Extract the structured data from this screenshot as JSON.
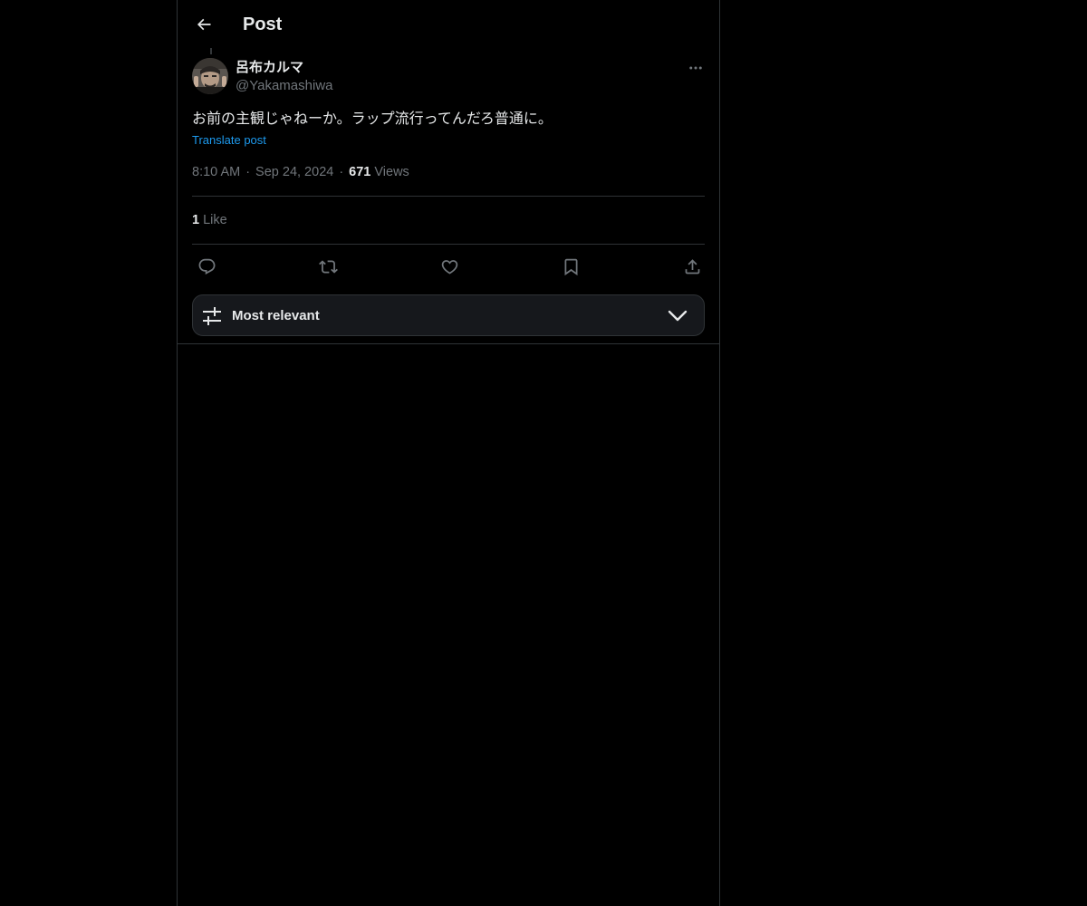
{
  "header": {
    "title": "Post",
    "back_icon": "arrow-left-icon"
  },
  "post": {
    "author": {
      "display_name": "呂布カルマ",
      "handle": "@Yakamashiwa"
    },
    "text": "お前の主観じゃねーか。ラップ流行ってんだろ普通に。",
    "translate_label": "Translate post",
    "time": "8:10 AM",
    "date": "Sep 24, 2024",
    "separator": "·",
    "views_count": "671",
    "views_label": "Views",
    "likes_count": "1",
    "likes_label": "Like"
  },
  "actions": [
    {
      "name": "reply-icon"
    },
    {
      "name": "repost-icon"
    },
    {
      "name": "like-icon"
    },
    {
      "name": "bookmark-icon"
    },
    {
      "name": "share-icon"
    }
  ],
  "sort": {
    "label": "Most relevant",
    "icon": "sliders-icon"
  },
  "colors": {
    "background": "#000000",
    "text": "#e7e9ea",
    "secondary": "#71767b",
    "accent": "#1d9bf0",
    "border": "#2f3336"
  }
}
